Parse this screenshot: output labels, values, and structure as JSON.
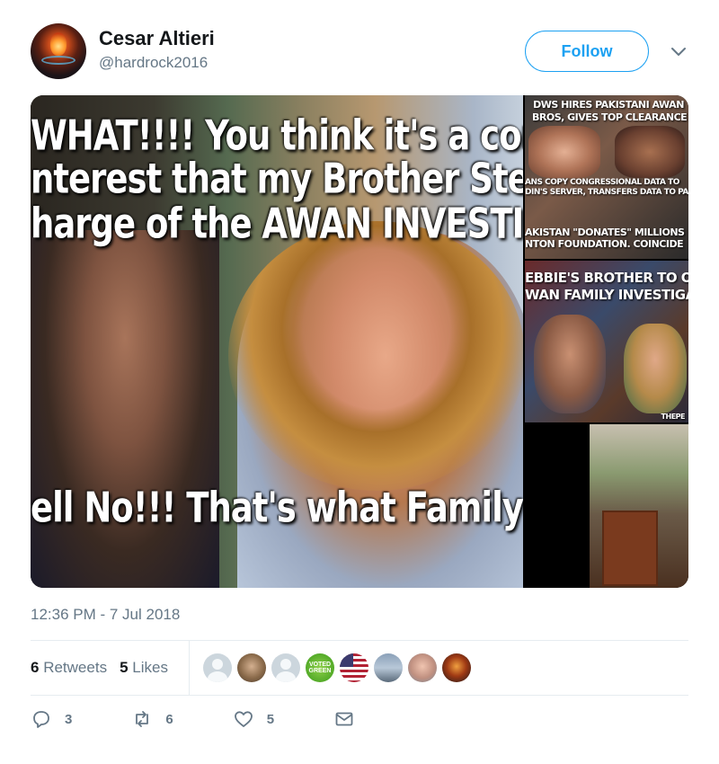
{
  "tweet": {
    "display_name": "Cesar Altieri",
    "handle": "@hardrock2016",
    "follow_label": "Follow",
    "timestamp": "12:36 PM - 7 Jul 2018"
  },
  "media": {
    "main_lines": [
      "WHAT!!!! You think it's a conf",
      "nterest that my Brother Ste",
      "harge of the AWAN INVESTIGA",
      "ell No!!! That's what Family'"
    ],
    "panel1_text": "DWS HIRES PAKISTANI AWAN\nBROS, GIVES TOP CLEARANCE",
    "panel1_sub": "ANS COPY CONGRESSIONAL DATA TO\nDIN'S SERVER, TRANSFERS DATA TO PA",
    "panel1_sub2": "AKISTAN \"DONATES\" MILLIONS\nNTON FOUNDATION. COINCIDE",
    "panel2_text": "EBBIE'S BROTHER TO OV\nWAN FAMILY INVESTIGA",
    "panel2_credit": "THEPE"
  },
  "stats": {
    "retweets_count": "6",
    "retweets_label": "Retweets",
    "likes_count": "5",
    "likes_label": "Likes"
  },
  "likers": [
    {
      "kind": "default"
    },
    {
      "kind": "photo1"
    },
    {
      "kind": "default"
    },
    {
      "kind": "green",
      "text": "VOTED GREEN"
    },
    {
      "kind": "flag"
    },
    {
      "kind": "sky"
    },
    {
      "kind": "face"
    },
    {
      "kind": "fire"
    }
  ],
  "actions": {
    "reply_count": "3",
    "retweet_count": "6",
    "like_count": "5"
  },
  "colors": {
    "accent": "#1da1f2",
    "muted": "#657786",
    "text": "#14171a",
    "divider": "#e6ecf0"
  }
}
